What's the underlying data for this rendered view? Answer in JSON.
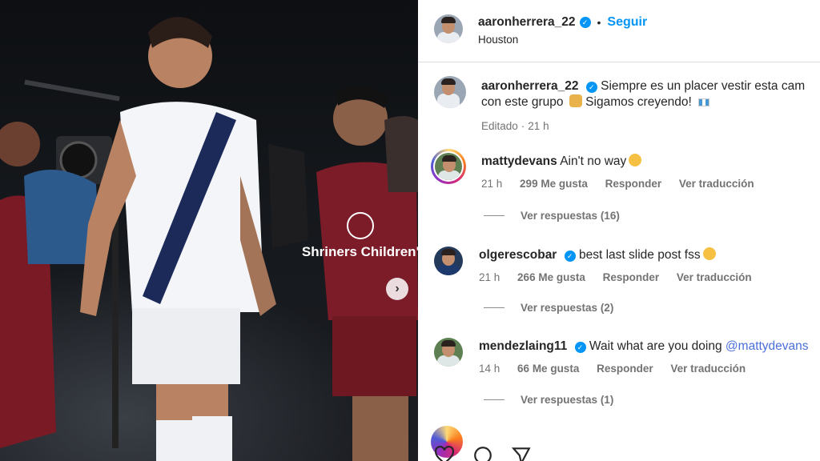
{
  "post": {
    "username": "aaronherrera_22",
    "follow_label": "Seguir",
    "separator": "•",
    "location": "Houston",
    "photo_label_shirt": "Shriners Children's",
    "caption_text": "Siempre es un placer vestir esta cam",
    "caption_line2": "con este grupo",
    "caption_line2_tail": "Sigamos creyendo!",
    "edited_label": "Editado",
    "edited_time": "21 h"
  },
  "comments": [
    {
      "username": "mattydevans",
      "text": "Ain't no way",
      "time": "21 h",
      "likes": "299 Me gusta",
      "reply_label": "Responder",
      "translate_label": "Ver traducción",
      "replies_label": "Ver respuestas (16)"
    },
    {
      "username": "olgerescobar",
      "text": "best last slide post fss",
      "time": "21 h",
      "likes": "266 Me gusta",
      "reply_label": "Responder",
      "translate_label": "Ver traducción",
      "replies_label": "Ver respuestas (2)"
    },
    {
      "username": "mendezlaing11",
      "text": "Wait what are you doing",
      "mention": "@mattydevans",
      "time": "14 h",
      "likes": "66 Me gusta",
      "reply_label": "Responder",
      "translate_label": "Ver traducción",
      "replies_label": "Ver respuestas (1)"
    }
  ],
  "colors": {
    "link_blue": "#0095f6",
    "mention_blue": "#4a6fd9",
    "muted_text": "#737373"
  },
  "icons": [
    "heart-icon",
    "comment-icon",
    "share-icon",
    "next-arrow-icon",
    "verified-badge-icon"
  ]
}
